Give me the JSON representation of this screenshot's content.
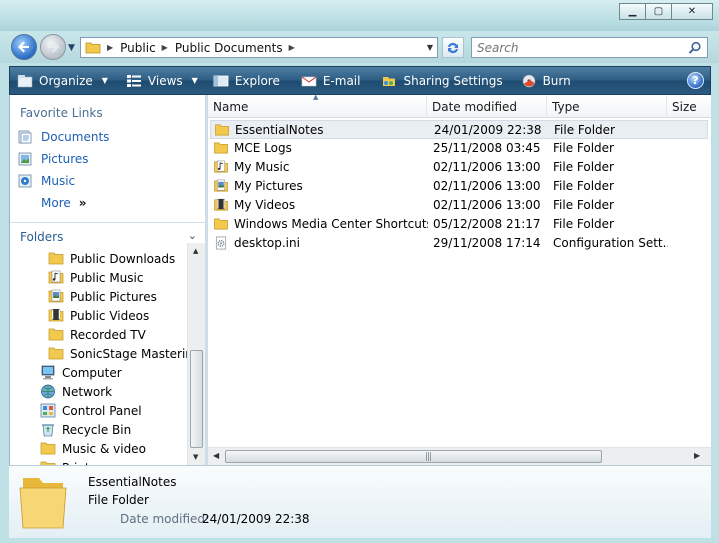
{
  "address": {
    "crumbs": [
      "Public",
      "Public Documents"
    ]
  },
  "search": {
    "placeholder": "Search"
  },
  "toolbar": {
    "organize": "Organize",
    "views": "Views",
    "explore": "Explore",
    "email": "E-mail",
    "sharing": "Sharing Settings",
    "burn": "Burn",
    "help": "?"
  },
  "navpane": {
    "favorite_links_label": "Favorite Links",
    "favorites": [
      {
        "label": "Documents",
        "icon": "documents-icon"
      },
      {
        "label": "Pictures",
        "icon": "pictures-icon"
      },
      {
        "label": "Music",
        "icon": "music-icon"
      }
    ],
    "more_label": "More",
    "more_arrows": "»",
    "folders_label": "Folders",
    "tree": [
      {
        "label": "Public Downloads",
        "icon": "folder-icon",
        "indent": 2
      },
      {
        "label": "Public Music",
        "icon": "music-folder-icon",
        "indent": 2
      },
      {
        "label": "Public Pictures",
        "icon": "pictures-folder-icon",
        "indent": 2
      },
      {
        "label": "Public Videos",
        "icon": "videos-folder-icon",
        "indent": 2
      },
      {
        "label": "Recorded TV",
        "icon": "folder-icon",
        "indent": 2
      },
      {
        "label": "SonicStage Mastering",
        "icon": "folder-icon",
        "indent": 2
      },
      {
        "label": "Computer",
        "icon": "computer-icon",
        "indent": 1
      },
      {
        "label": "Network",
        "icon": "network-icon",
        "indent": 1
      },
      {
        "label": "Control Panel",
        "icon": "control-panel-icon",
        "indent": 1
      },
      {
        "label": "Recycle Bin",
        "icon": "recycle-bin-icon",
        "indent": 1
      },
      {
        "label": "Music & video",
        "icon": "folder-icon",
        "indent": 1
      },
      {
        "label": "Print",
        "icon": "folder-icon",
        "indent": 1
      }
    ]
  },
  "filelist": {
    "columns": {
      "name": "Name",
      "date": "Date modified",
      "type": "Type",
      "size": "Size"
    },
    "rows": [
      {
        "name": "EssentialNotes",
        "date": "24/01/2009 22:38",
        "type": "File Folder",
        "icon": "folder-icon",
        "selected": true
      },
      {
        "name": "MCE Logs",
        "date": "25/11/2008 03:45",
        "type": "File Folder",
        "icon": "folder-icon"
      },
      {
        "name": "My Music",
        "date": "02/11/2006 13:00",
        "type": "File Folder",
        "icon": "music-folder-icon"
      },
      {
        "name": "My Pictures",
        "date": "02/11/2006 13:00",
        "type": "File Folder",
        "icon": "pictures-folder-icon"
      },
      {
        "name": "My Videos",
        "date": "02/11/2006 13:00",
        "type": "File Folder",
        "icon": "videos-folder-icon"
      },
      {
        "name": "Windows Media Center Shortcuts",
        "date": "05/12/2008 21:17",
        "type": "File Folder",
        "icon": "folder-icon"
      },
      {
        "name": "desktop.ini",
        "date": "29/11/2008 17:14",
        "type": "Configuration Sett...",
        "icon": "settings-file-icon"
      }
    ]
  },
  "details": {
    "name": "EssentialNotes",
    "type": "File Folder",
    "date_label": "Date modified:",
    "date_value": "24/01/2009 22:38"
  },
  "colors": {
    "toolbar": "#2c5c82",
    "link": "#1c5fb6",
    "section_label": "#4c6e95",
    "folder": "#f2c94c"
  }
}
